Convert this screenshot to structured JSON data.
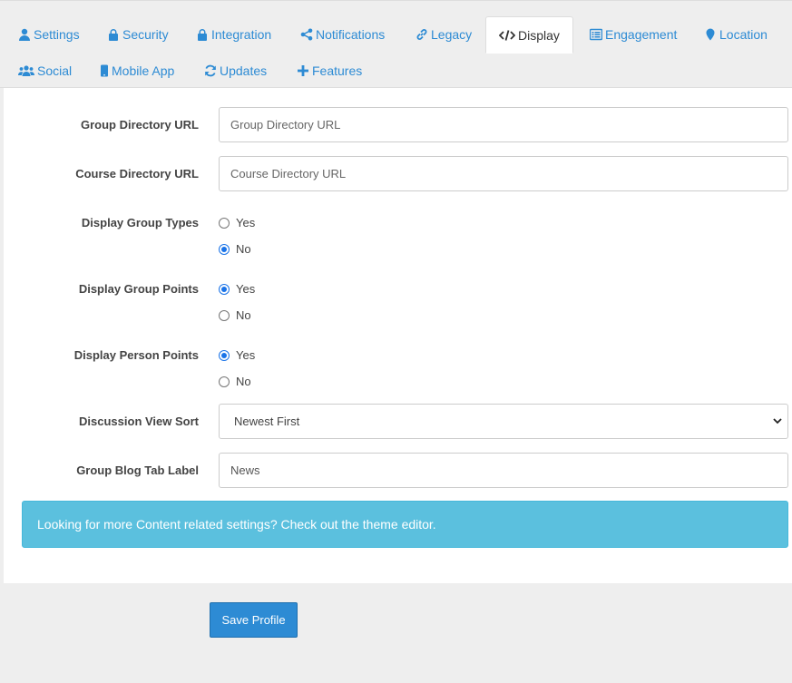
{
  "tabs": [
    {
      "label": "Settings",
      "icon": "user-icon"
    },
    {
      "label": "Security",
      "icon": "lock-icon"
    },
    {
      "label": "Integration",
      "icon": "lock-icon"
    },
    {
      "label": "Notifications",
      "icon": "share-icon"
    },
    {
      "label": "Legacy",
      "icon": "link-icon"
    },
    {
      "label": "Display",
      "icon": "code-icon",
      "active": true
    },
    {
      "label": "Engagement",
      "icon": "list-icon"
    },
    {
      "label": "Location",
      "icon": "map-marker-icon"
    },
    {
      "label": "Social",
      "icon": "users-icon"
    },
    {
      "label": "Mobile App",
      "icon": "mobile-icon"
    },
    {
      "label": "Updates",
      "icon": "refresh-icon"
    },
    {
      "label": "Features",
      "icon": "plus-icon"
    }
  ],
  "form": {
    "group_directory_url": {
      "label": "Group Directory URL",
      "value": "",
      "placeholder": "Group Directory URL"
    },
    "course_directory_url": {
      "label": "Course Directory URL",
      "value": "",
      "placeholder": "Course Directory URL"
    },
    "display_group_types": {
      "label": "Display Group Types",
      "yes": "Yes",
      "no": "No",
      "selected": "No"
    },
    "display_group_points": {
      "label": "Display Group Points",
      "yes": "Yes",
      "no": "No",
      "selected": "Yes"
    },
    "display_person_points": {
      "label": "Display Person Points",
      "yes": "Yes",
      "no": "No",
      "selected": "Yes"
    },
    "discussion_view_sort": {
      "label": "Discussion View Sort",
      "selected": "Newest First"
    },
    "group_blog_tab_label": {
      "label": "Group Blog Tab Label",
      "value": "News",
      "placeholder": ""
    }
  },
  "alert": {
    "text": "Looking for more Content related settings? Check out the theme editor."
  },
  "save_button": {
    "label": "Save Profile"
  },
  "colors": {
    "accent": "#2d8bd4",
    "alert_bg": "#5bc0de",
    "radio_on": "#1a73e8"
  }
}
